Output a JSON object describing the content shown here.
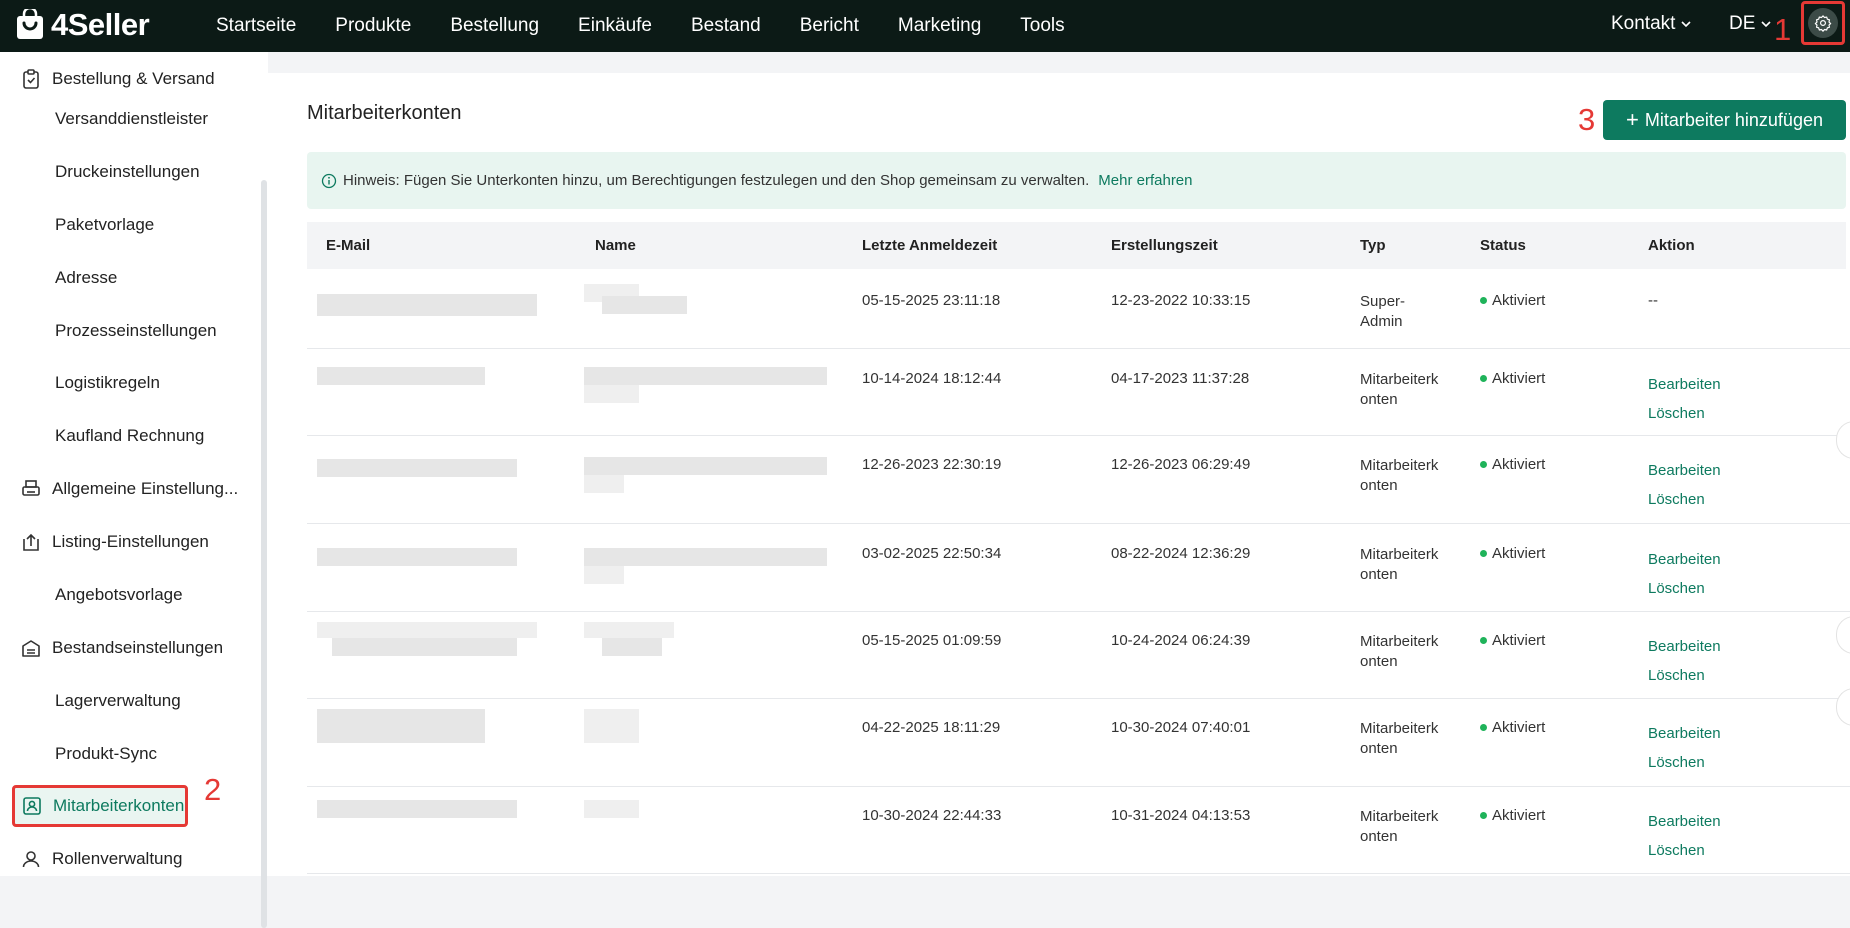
{
  "app": {
    "name": "4Seller"
  },
  "topnav": {
    "items": [
      "Startseite",
      "Produkte",
      "Bestellung",
      "Einkäufe",
      "Bestand",
      "Bericht",
      "Marketing",
      "Tools"
    ],
    "contact_label": "Kontakt",
    "language": "DE"
  },
  "annotations": {
    "marker_1": "1",
    "marker_2": "2",
    "marker_3": "3"
  },
  "sidebar": {
    "items": [
      {
        "label": "Bestellung & Versand",
        "level": "group",
        "icon": "clipboard-check-icon"
      },
      {
        "label": "Versanddienstleister",
        "level": "sub"
      },
      {
        "label": "Druckeinstellungen",
        "level": "sub"
      },
      {
        "label": "Paketvorlage",
        "level": "sub"
      },
      {
        "label": "Adresse",
        "level": "sub"
      },
      {
        "label": "Prozesseinstellungen",
        "level": "sub"
      },
      {
        "label": "Logistikregeln",
        "level": "sub"
      },
      {
        "label": "Kaufland Rechnung",
        "level": "sub"
      },
      {
        "label": "Allgemeine Einstellung...",
        "level": "group",
        "icon": "printer-icon"
      },
      {
        "label": "Listing-Einstellungen",
        "level": "group",
        "icon": "upload-box-icon"
      },
      {
        "label": "Angebotsvorlage",
        "level": "sub"
      },
      {
        "label": "Bestandseinstellungen",
        "level": "group",
        "icon": "warehouse-icon"
      },
      {
        "label": "Lagerverwaltung",
        "level": "sub"
      },
      {
        "label": "Produkt-Sync",
        "level": "sub"
      },
      {
        "label": "Mitarbeiterkonten",
        "level": "group",
        "icon": "badge-user-icon",
        "active": true
      },
      {
        "label": "Rollenverwaltung",
        "level": "group",
        "icon": "user-icon"
      }
    ]
  },
  "main": {
    "title": "Mitarbeiterkonten",
    "add_button": "Mitarbeiter hinzufügen",
    "hint_text": "Hinweis: Fügen Sie Unterkonten hinzu, um Berechtigungen festzulegen und den Shop gemeinsam zu verwalten.",
    "hint_link": "Mehr erfahren"
  },
  "table": {
    "columns": [
      "E-Mail",
      "Name",
      "Letzte Anmeldezeit",
      "Erstellungszeit",
      "Typ",
      "Status",
      "Aktion"
    ],
    "rows": [
      {
        "last_login": "05-15-2025 23:11:18",
        "created": "12-23-2022 10:33:15",
        "type_l1": "Super-",
        "type_l2": "Admin",
        "status": "Aktiviert",
        "action_none": "--"
      },
      {
        "last_login": "10-14-2024 18:12:44",
        "created": "04-17-2023 11:37:28",
        "type_l1": "Mitarbeiterk",
        "type_l2": "onten",
        "status": "Aktiviert",
        "edit": "Bearbeiten",
        "delete": "Löschen"
      },
      {
        "last_login": "12-26-2023 22:30:19",
        "created": "12-26-2023 06:29:49",
        "type_l1": "Mitarbeiterk",
        "type_l2": "onten",
        "status": "Aktiviert",
        "edit": "Bearbeiten",
        "delete": "Löschen"
      },
      {
        "last_login": "03-02-2025 22:50:34",
        "created": "08-22-2024 12:36:29",
        "type_l1": "Mitarbeiterk",
        "type_l2": "onten",
        "status": "Aktiviert",
        "edit": "Bearbeiten",
        "delete": "Löschen"
      },
      {
        "last_login": "05-15-2025 01:09:59",
        "created": "10-24-2024 06:24:39",
        "type_l1": "Mitarbeiterk",
        "type_l2": "onten",
        "status": "Aktiviert",
        "edit": "Bearbeiten",
        "delete": "Löschen"
      },
      {
        "last_login": "04-22-2025 18:11:29",
        "created": "10-30-2024 07:40:01",
        "type_l1": "Mitarbeiterk",
        "type_l2": "onten",
        "status": "Aktiviert",
        "edit": "Bearbeiten",
        "delete": "Löschen"
      },
      {
        "last_login": "10-30-2024 22:44:33",
        "created": "10-31-2024 04:13:53",
        "type_l1": "Mitarbeiterk",
        "type_l2": "onten",
        "status": "Aktiviert",
        "edit": "Bearbeiten",
        "delete": "Löschen"
      }
    ]
  },
  "colors": {
    "brand": "#0d7a5f",
    "topbar": "#0c1a16",
    "annotation": "#e53935",
    "status_active": "#1fb35a"
  }
}
